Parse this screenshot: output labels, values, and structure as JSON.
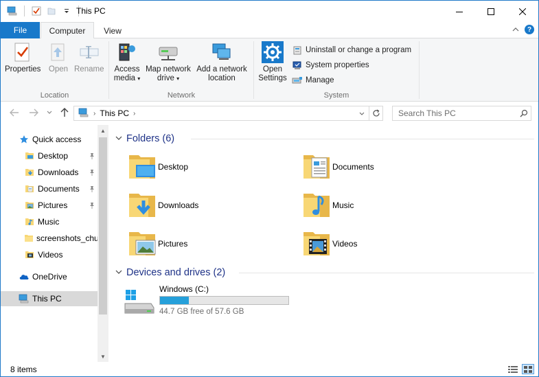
{
  "window": {
    "title": "This PC"
  },
  "quick_access_toolbar": {
    "icons": [
      "this-pc-icon",
      "properties-check-icon",
      "new-folder-icon",
      "customize-dropdown-icon"
    ]
  },
  "ribbon_tabs": {
    "file": "File",
    "computer": "Computer",
    "view": "View"
  },
  "ribbon": {
    "location": {
      "label": "Location",
      "properties": "Properties",
      "open": "Open",
      "rename": "Rename"
    },
    "network": {
      "label": "Network",
      "access_media_1": "Access",
      "access_media_2": "media",
      "map_drive_1": "Map network",
      "map_drive_2": "drive",
      "add_location_1": "Add a network",
      "add_location_2": "location"
    },
    "system": {
      "label": "System",
      "open_settings_1": "Open",
      "open_settings_2": "Settings",
      "uninstall": "Uninstall or change a program",
      "system_properties": "System properties",
      "manage": "Manage"
    }
  },
  "address_bar": {
    "path": "This PC",
    "search_placeholder": "Search This PC"
  },
  "nav_pane": {
    "quick_access": "Quick access",
    "items": [
      {
        "label": "Desktop",
        "pinned": true
      },
      {
        "label": "Downloads",
        "pinned": true
      },
      {
        "label": "Documents",
        "pinned": true
      },
      {
        "label": "Pictures",
        "pinned": true
      },
      {
        "label": "Music",
        "pinned": false
      },
      {
        "label": "screenshots_chu",
        "pinned": false
      },
      {
        "label": "Videos",
        "pinned": false
      }
    ],
    "onedrive": "OneDrive",
    "this_pc": "This PC"
  },
  "content": {
    "folders_header": "Folders (6)",
    "folders": [
      {
        "label": "Desktop",
        "icon": "desktop-folder-icon"
      },
      {
        "label": "Documents",
        "icon": "documents-folder-icon"
      },
      {
        "label": "Downloads",
        "icon": "downloads-folder-icon"
      },
      {
        "label": "Music",
        "icon": "music-folder-icon"
      },
      {
        "label": "Pictures",
        "icon": "pictures-folder-icon"
      },
      {
        "label": "Videos",
        "icon": "videos-folder-icon"
      }
    ],
    "devices_header": "Devices and drives (2)",
    "drives": [
      {
        "name": "Windows (C:)",
        "free_text": "44.7 GB free of 57.6 GB",
        "used_fraction": 0.224
      }
    ]
  },
  "status_bar": {
    "item_count": "8 items"
  },
  "colors": {
    "accent": "#1979ca",
    "drive_bar": "#26a0da",
    "folder": "#f8d775",
    "section_header": "#1e3287"
  }
}
